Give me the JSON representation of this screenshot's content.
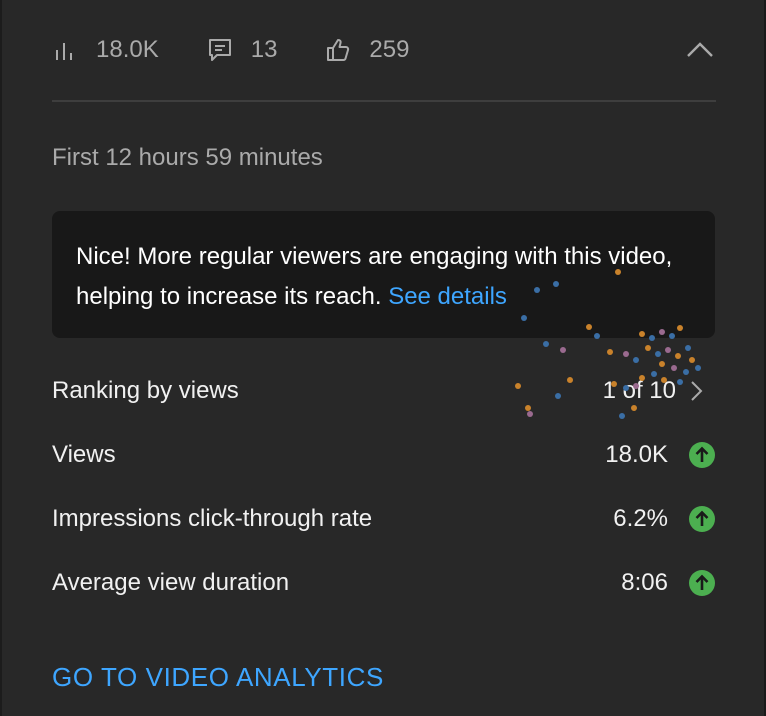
{
  "stats": {
    "views": "18.0K",
    "comments": "13",
    "likes": "259"
  },
  "period": "First 12 hours 59 minutes",
  "insight": {
    "text": "Nice! More regular viewers are engaging with this video, helping to increase its reach.",
    "link": "See details"
  },
  "metrics": [
    {
      "label": "Ranking by views",
      "value": "1 of 10"
    },
    {
      "label": "Views",
      "value": "18.0K"
    },
    {
      "label": "Impressions click-through rate",
      "value": "6.2%"
    },
    {
      "label": "Average view duration",
      "value": "8:06"
    }
  ],
  "analytics_link": "GO TO VIDEO ANALYTICS",
  "colors": {
    "accent_blue": "#3ea6ff",
    "trend_green": "#4caf50",
    "card_bg": "#282828",
    "insight_bg": "#181818"
  },
  "icons": {
    "views": "bar-chart-icon",
    "comments": "comment-icon",
    "likes": "thumbs-up-icon",
    "collapse": "chevron-up-icon",
    "trend": "arrow-up-circle-icon",
    "ranking": "chevron-right-icon"
  }
}
